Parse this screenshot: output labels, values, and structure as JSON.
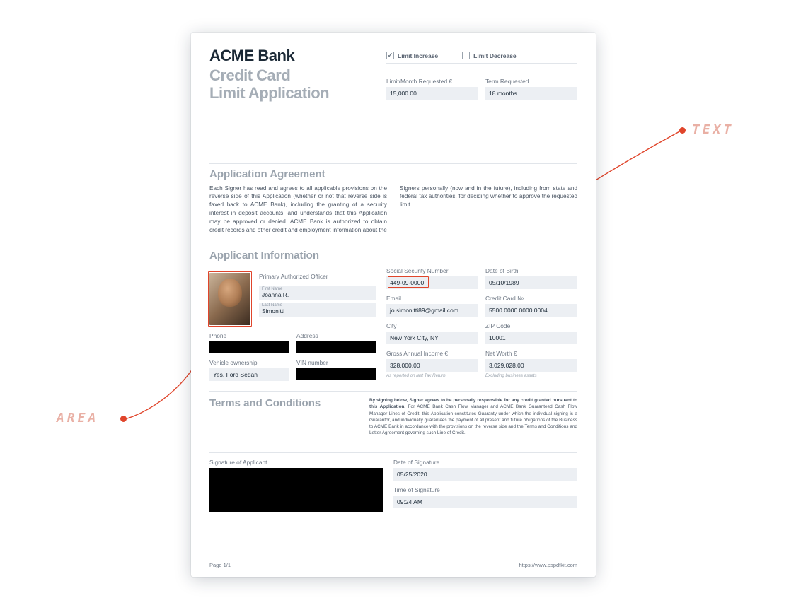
{
  "callouts": {
    "text": "TEXT",
    "area": "AREA"
  },
  "header": {
    "bank": "ACME Bank",
    "subtitle1": "Credit Card",
    "subtitle2": "Limit Application"
  },
  "request_type": {
    "increase_label": "Limit Increase",
    "decrease_label": "Limit Decrease",
    "increase_checked": true,
    "decrease_checked": false
  },
  "request_fields": {
    "limit_label": "Limit/Month Requested €",
    "limit_value": "15,000.00",
    "term_label": "Term Requested",
    "term_value": "18 months"
  },
  "agreement": {
    "title": "Application Agreement",
    "col1": "Each Signer has read and agrees to all applicable provisions on the reverse side of this Application (whether or not that reverse side is faxed back to ACME Bank), including the granting of a security interest in deposit accounts, and understands that this Application may be approved or denied. ACME Bank is authorized to obtain credit records and other credit and employment information about the",
    "col2": "Signers personally (now and in the future), including from state and federal tax authorities, for deciding whether to approve the requested limit."
  },
  "applicant": {
    "title": "Applicant Information",
    "officer_label": "Primary Authorized Officer",
    "first_name_label": "First Name",
    "first_name": "Joanna R.",
    "last_name_label": "Last Name",
    "last_name": "Simonitti",
    "ssn_label": "Social Security Number",
    "ssn": "449-09-0000",
    "dob_label": "Date of Birth",
    "dob": "05/10/1989",
    "email_label": "Email",
    "email": "jo.simonitti89@gmail.com",
    "cc_label": "Credit Card №",
    "cc": "5500 0000 0000 0004",
    "phone_label": "Phone",
    "address_label": "Address",
    "city_label": "City",
    "city": "New York City, NY",
    "zip_label": "ZIP Code",
    "zip": "10001",
    "vehicle_label": "Vehicle ownership",
    "vehicle": "Yes, Ford Sedan",
    "vin_label": "VIN number",
    "income_label": "Gross Annual Income €",
    "income": "328,000.00",
    "income_note": "As reported on last Tax Return",
    "networth_label": "Net Worth €",
    "networth": "3,029,028.00",
    "networth_note": "Excluding business assets"
  },
  "terms": {
    "title": "Terms and Conditions",
    "body_bold": "By signing below, Signer agrees to be personally responsible for any credit granted pursuant to this Application.",
    "body_rest": " For ACME Bank Cash Flow Manager and ACME Bank Guaranteed Cash Flow Manager Lines of Credit, this Application constitutes Guaranty under which the individual signing is a Guarantor, and individually guarantees the payment of all present and future obligations of the Business to ACME Bank in accordance with the provisions on the reverse side and the Terms and Conditions and Letter Agreement governing such Line of Credit."
  },
  "signature": {
    "sig_label": "Signature of Applicant",
    "date_label": "Date of Signature",
    "date": "05/25/2020",
    "time_label": "Time of Signature",
    "time": "09:24 AM"
  },
  "footer": {
    "page": "Page 1/1",
    "url": "https://www.pspdfkit.com"
  }
}
